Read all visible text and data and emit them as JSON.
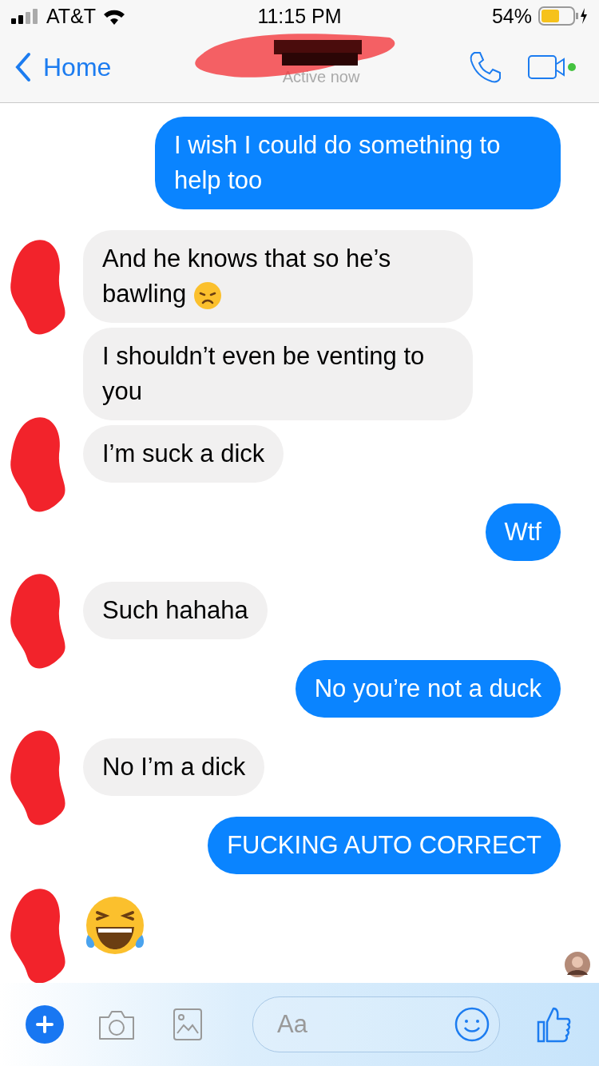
{
  "status_bar": {
    "carrier": "AT&T",
    "time": "11:15 PM",
    "battery": "54%"
  },
  "header": {
    "back": "Home",
    "subtitle": "Active now"
  },
  "messages": [
    {
      "outgoing": true,
      "kind": "text",
      "text": "I wish I could do something to help too"
    },
    {
      "outgoing": false,
      "kind": "text_sad",
      "text": "And he knows that so he’s bawling",
      "avatar": true
    },
    {
      "outgoing": false,
      "kind": "text",
      "text": "I shouldn’t even be venting to you",
      "avatar": false
    },
    {
      "outgoing": false,
      "kind": "text",
      "text": "I’m suck a dick",
      "avatar": true
    },
    {
      "outgoing": true,
      "kind": "text",
      "text": "Wtf"
    },
    {
      "outgoing": false,
      "kind": "text",
      "text": "Such hahaha",
      "avatar": true
    },
    {
      "outgoing": true,
      "kind": "text",
      "text": "No you’re not a duck"
    },
    {
      "outgoing": false,
      "kind": "text",
      "text": "No I’m a dick",
      "avatar": true
    },
    {
      "outgoing": true,
      "kind": "text",
      "text": "FUCKING AUTO CORRECT"
    },
    {
      "outgoing": false,
      "kind": "laughing_emoji",
      "avatar": true
    }
  ],
  "composer": {
    "placeholder": "Aa"
  }
}
